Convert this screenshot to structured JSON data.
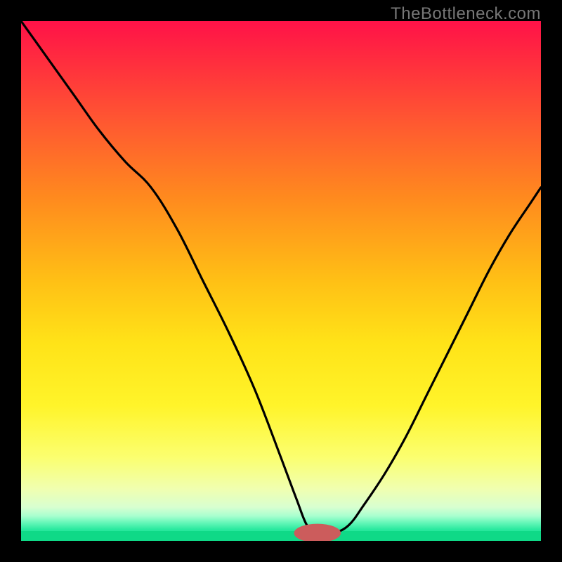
{
  "watermark": "TheBottleneck.com",
  "colors": {
    "bg": "#000000",
    "curve": "#000000",
    "marker_fill": "#cc5c5c",
    "marker_stroke": "#cc5c5c",
    "gradient_stops": [
      {
        "offset": 0.0,
        "color": "#ff1248"
      },
      {
        "offset": 0.08,
        "color": "#ff2e3e"
      },
      {
        "offset": 0.2,
        "color": "#ff5a30"
      },
      {
        "offset": 0.34,
        "color": "#ff8a1e"
      },
      {
        "offset": 0.5,
        "color": "#ffc015"
      },
      {
        "offset": 0.62,
        "color": "#ffe318"
      },
      {
        "offset": 0.74,
        "color": "#fff42a"
      },
      {
        "offset": 0.84,
        "color": "#fbff70"
      },
      {
        "offset": 0.9,
        "color": "#f0ffb0"
      },
      {
        "offset": 0.935,
        "color": "#d8ffd0"
      },
      {
        "offset": 0.952,
        "color": "#a8ffcf"
      },
      {
        "offset": 0.965,
        "color": "#65f7b8"
      },
      {
        "offset": 0.978,
        "color": "#29e99e"
      },
      {
        "offset": 1.0,
        "color": "#0fd987"
      }
    ],
    "floor_band": "#0fd987"
  },
  "chart_data": {
    "type": "line",
    "title": "",
    "xlabel": "",
    "ylabel": "",
    "xlim": [
      0,
      100
    ],
    "ylim": [
      0,
      100
    ],
    "marker": {
      "x": 57,
      "y": 1.5,
      "rx": 4.5,
      "ry": 1.8
    },
    "series": [
      {
        "name": "bottleneck-curve",
        "x": [
          0,
          5,
          10,
          15,
          20,
          25,
          30,
          35,
          40,
          45,
          50,
          53,
          55,
          57,
          60,
          63,
          66,
          70,
          74,
          78,
          82,
          86,
          90,
          94,
          98,
          100
        ],
        "y": [
          100,
          93,
          86,
          79,
          73,
          68,
          60,
          50,
          40,
          29,
          16,
          8,
          3,
          1.5,
          1.5,
          3,
          7,
          13,
          20,
          28,
          36,
          44,
          52,
          59,
          65,
          68
        ]
      }
    ]
  }
}
